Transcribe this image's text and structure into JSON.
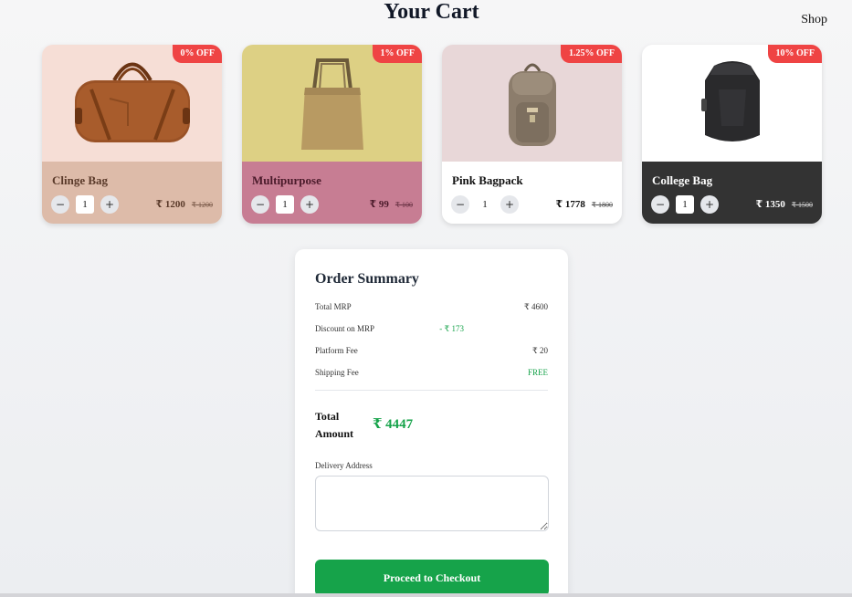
{
  "header": {
    "title": "Your Cart",
    "shop_link": "Shop"
  },
  "products": [
    {
      "name": "Clinge Bag",
      "badge": "0% OFF",
      "qty": "1",
      "price": "₹ 1200",
      "mrp": "₹ 1200",
      "img_bg": "#f6ded6",
      "body_bg": "#ddbba9",
      "text_color": "#5a3a2a",
      "icon": "duffel-bag-icon"
    },
    {
      "name": "Multipurpose",
      "badge": "1% OFF",
      "qty": "1",
      "price": "₹ 99",
      "mrp": "₹ 100",
      "img_bg": "#ddd084",
      "body_bg": "#c77d93",
      "text_color": "#4a1a2a",
      "icon": "tote-bag-icon"
    },
    {
      "name": "Pink Bagpack",
      "badge": "1.25% OFF",
      "qty": "1",
      "price": "₹ 1778",
      "mrp": "₹ 1800",
      "img_bg": "#e8d7d8",
      "body_bg": "#ffffff",
      "text_color": "#111111",
      "icon": "backpack-icon"
    },
    {
      "name": "College Bag",
      "badge": "10% OFF",
      "qty": "1",
      "price": "₹ 1350",
      "mrp": "₹ 1500",
      "img_bg": "#ffffff",
      "body_bg": "#333333",
      "text_color": "#ffffff",
      "icon": "laptop-backpack-icon"
    }
  ],
  "summary": {
    "title": "Order Summary",
    "rows": [
      {
        "label": "Total MRP",
        "value": "₹ 4600"
      },
      {
        "label": "Discount on MRP",
        "value": "- ₹ 173"
      },
      {
        "label": "Platform Fee",
        "value": "₹ 20"
      },
      {
        "label": "Shipping Fee",
        "value": "FREE"
      }
    ],
    "total_label": "Total Amount",
    "total_value": "₹ 4447",
    "address_label": "Delivery Address",
    "address_value": "",
    "checkout_label": "Proceed to Checkout"
  },
  "colors": {
    "accent": "#16a34a",
    "badge": "#ef4444"
  }
}
